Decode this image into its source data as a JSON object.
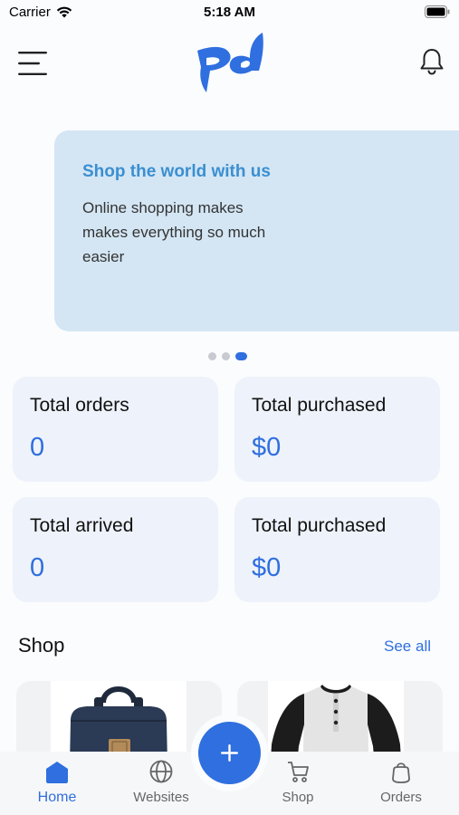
{
  "status_bar": {
    "carrier": "Carrier",
    "time": "5:18 AM"
  },
  "header": {
    "menu_icon": "hamburger-menu-icon",
    "logo_icon": "pd-logo",
    "bell_icon": "bell-icon"
  },
  "banner": {
    "title": "Shop the world with us",
    "text": "Online shopping makes makes everything so much easier",
    "page_count": 3,
    "active_page": 3
  },
  "stats": [
    {
      "label": "Total orders",
      "value": "0"
    },
    {
      "label": "Total purchased",
      "value": "$0"
    },
    {
      "label": "Total arrived",
      "value": "0"
    },
    {
      "label": "Total purchased",
      "value": "$0"
    }
  ],
  "shop": {
    "title": "Shop",
    "see_all": "See all"
  },
  "tabs": [
    {
      "label": "Home",
      "icon": "home-icon",
      "active": true
    },
    {
      "label": "Websites",
      "icon": "globe-icon",
      "active": false
    },
    {
      "label": "Shop",
      "icon": "cart-icon",
      "active": false
    },
    {
      "label": "Orders",
      "icon": "bag-icon",
      "active": false
    }
  ],
  "fab_icon": "plus-icon",
  "colors": {
    "accent": "#2f6fdf",
    "banner_bg": "#d4e6f4",
    "banner_title": "#3b8fd1",
    "card_bg": "#eef2fa"
  }
}
